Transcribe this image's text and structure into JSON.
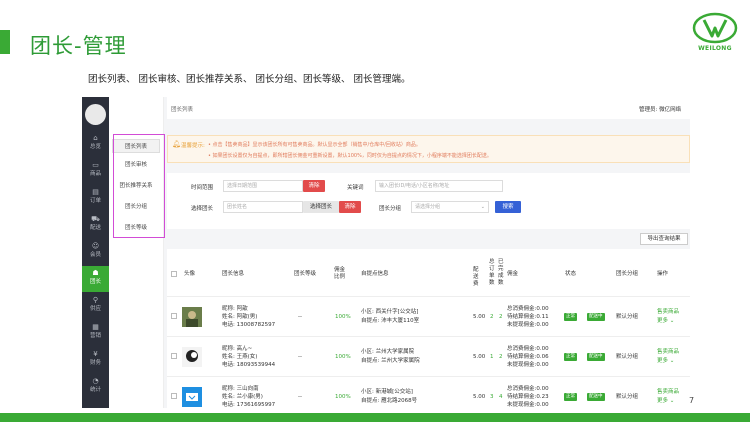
{
  "slide": {
    "title": "团长-管理",
    "subtitle": "团长列表、 团长审核、团长推荐关系、 团长分组、团长等级、 团长管理端。",
    "page_number": "7",
    "logo_text": "WEILONG",
    "accent_color": "#3aaa35"
  },
  "nav": {
    "items": [
      {
        "icon": "⌂",
        "label": "总览"
      },
      {
        "icon": "▭",
        "label": "商品"
      },
      {
        "icon": "▤",
        "label": "订单"
      },
      {
        "icon": "⛟",
        "label": "配送"
      },
      {
        "icon": "☺",
        "label": "会员"
      },
      {
        "icon": "☗",
        "label": "团长"
      },
      {
        "icon": "⚲",
        "label": "供应"
      },
      {
        "icon": "▦",
        "label": "营销"
      },
      {
        "icon": "¥",
        "label": "财务"
      },
      {
        "icon": "◔",
        "label": "统计"
      }
    ],
    "active_index": 5
  },
  "submenu": {
    "items": [
      "团长列表",
      "团长审核",
      "团长推荐关系",
      "团长分组",
      "团长等级"
    ],
    "active_index": 0
  },
  "topbar": {
    "breadcrumb": "团长列表",
    "admin": "管理员: 微亿网络"
  },
  "notice": {
    "title": "温馨提示:",
    "line1": "• 点击【售卖商品】显示该团长所有可售卖商品。默认显示全部（销售中/仓库中/回收站）商品。",
    "line2": "• 如果团长设置仅为自提点，即所辖团长佣金可重新设置，默认100%，同时仅为自提点的情况下，小程序端不能选择团长配送。"
  },
  "filter": {
    "date_label": "时间范围",
    "date_placeholder": "选择日期范围",
    "clear_label": "清除",
    "keyword_label": "关键词",
    "keyword_placeholder": "输入团长ID/电话/小区名称/地址",
    "select_head_label": "选择团长",
    "head_name_placeholder": "团长姓名",
    "select_head_button": "选择团长",
    "clear_label2": "清除",
    "group_label": "团长分组",
    "group_placeholder": "请选择分组",
    "search_button": "搜索"
  },
  "export_button": "导出查询结果",
  "table": {
    "headers": {
      "avatar": "头像",
      "info": "团长信息",
      "level": "团长等级",
      "commission_ratio": "佣金比例",
      "pickup": "自提点信息",
      "delivery_fee": "配送费",
      "total_orders": "总订单数",
      "completed_orders": "已完成数",
      "commission": "佣金",
      "status": "状态",
      "group": "团长分组",
      "actions": "操作"
    },
    "rows": [
      {
        "nickname": "昵称: 阿歆",
        "name": "姓名: 阿歆(男)",
        "phone": "电话: 13008782597",
        "level": "--",
        "ratio": "100%",
        "community": "小区: 西关什字[公交站]",
        "pickup_point": "自提点: 沛丰大厦110室",
        "fee": "5.00",
        "orders": "2",
        "completed": "2",
        "comm_total": "总消费佣金:0.00",
        "comm_pending": "待结算佣金:0.11",
        "comm_unwithdrawn": "未提现佣金:0.00",
        "status_tag": "正常",
        "delivery_tag": "配送中",
        "group": "默认分组",
        "action1": "售卖商品",
        "action2": "更多"
      },
      {
        "nickname": "昵称: 高ん~",
        "name": "姓名: 王燕(女)",
        "phone": "电话: 18093539944",
        "level": "--",
        "ratio": "100%",
        "community": "小区: 兰州大学家属院",
        "pickup_point": "自提点: 兰州大学家属院",
        "fee": "5.00",
        "orders": "1",
        "completed": "2",
        "comm_total": "总消费佣金:0.00",
        "comm_pending": "待结算佣金:0.06",
        "comm_unwithdrawn": "未提现佣金:0.00",
        "status_tag": "正常",
        "delivery_tag": "配送中",
        "group": "默认分组",
        "action1": "售卖商品",
        "action2": "更多"
      },
      {
        "nickname": "昵称: 三山向南",
        "name": "姓名: 兰小康(男)",
        "phone": "电话: 17361695997",
        "level": "--",
        "ratio": "100%",
        "community": "小区: 新港城[公交站]",
        "pickup_point": "自提点: 雁北路2068号",
        "fee": "5.00",
        "orders": "3",
        "completed": "4",
        "comm_total": "总消费佣金:0.00",
        "comm_pending": "待结算佣金:0.23",
        "comm_unwithdrawn": "未提现佣金:0.00",
        "status_tag": "正常",
        "delivery_tag": "配送中",
        "group": "默认分组",
        "action1": "售卖商品",
        "action2": "更多"
      }
    ]
  }
}
